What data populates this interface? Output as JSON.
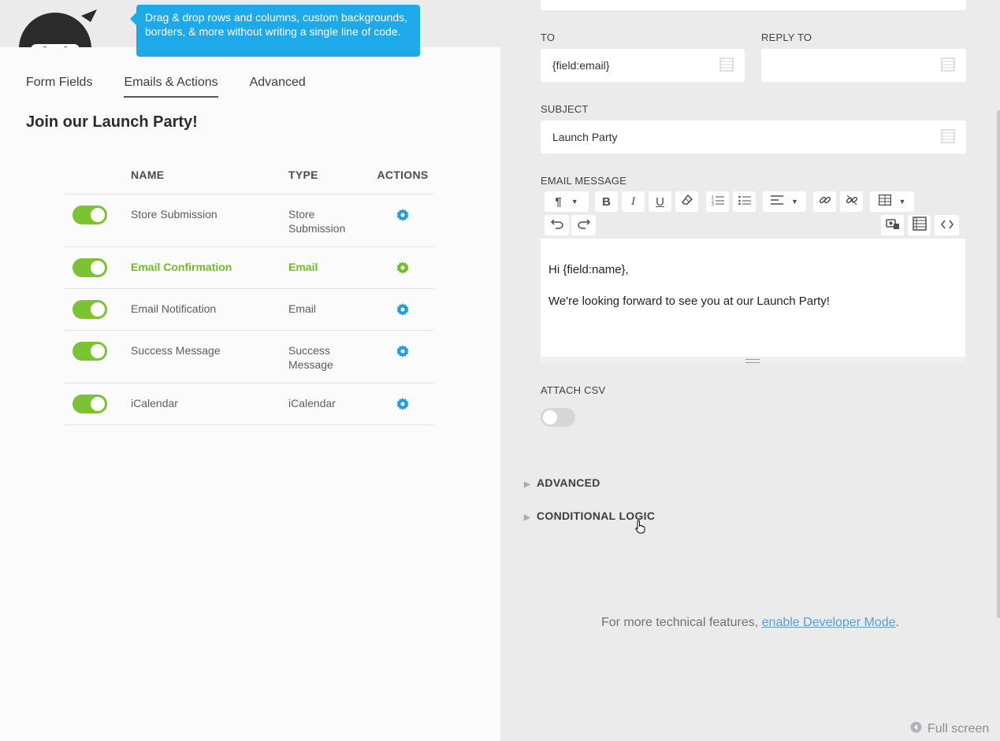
{
  "tooltip": {
    "text": "Drag & drop rows and columns, custom backgrounds, borders, & more without writing a single line of code."
  },
  "tabs": [
    {
      "label": "Form Fields",
      "active": false
    },
    {
      "label": "Emails & Actions",
      "active": true
    },
    {
      "label": "Advanced",
      "active": false
    }
  ],
  "form": {
    "title": "Join our Launch Party!"
  },
  "table": {
    "headers": {
      "name": "NAME",
      "type": "TYPE",
      "actions": "ACTIONS"
    },
    "rows": [
      {
        "name": "Store Submission",
        "type": "Store Submission",
        "enabled": true
      },
      {
        "name": "Email Confirmation",
        "type": "Email",
        "enabled": true,
        "highlight": true
      },
      {
        "name": "Email Notification",
        "type": "Email",
        "enabled": true
      },
      {
        "name": "Success Message",
        "type": "Success Message",
        "enabled": true
      },
      {
        "name": "iCalendar",
        "type": "iCalendar",
        "enabled": true
      }
    ]
  },
  "email": {
    "to_label": "TO",
    "to_value": "{field:email}",
    "reply_label": "REPLY TO",
    "reply_value": "",
    "subject_label": "SUBJECT",
    "subject_value": "Launch Party",
    "message_label": "EMAIL MESSAGE",
    "message_line1": "Hi {field:name},",
    "message_line2": "We're looking forward to see you at our Launch Party!",
    "attach_label": "ATTACH CSV",
    "attach_enabled": false
  },
  "sections": {
    "advanced": "ADVANCED",
    "conditional": "CONDITIONAL LOGIC"
  },
  "footer": {
    "prefix": "For more technical features, ",
    "link": "enable Developer Mode",
    "suffix": "."
  },
  "fullscreen": {
    "label": "Full screen"
  },
  "colors": {
    "accent_green": "#7cc334",
    "accent_blue": "#1ea9ea",
    "gear_blue": "#1e9be8"
  }
}
